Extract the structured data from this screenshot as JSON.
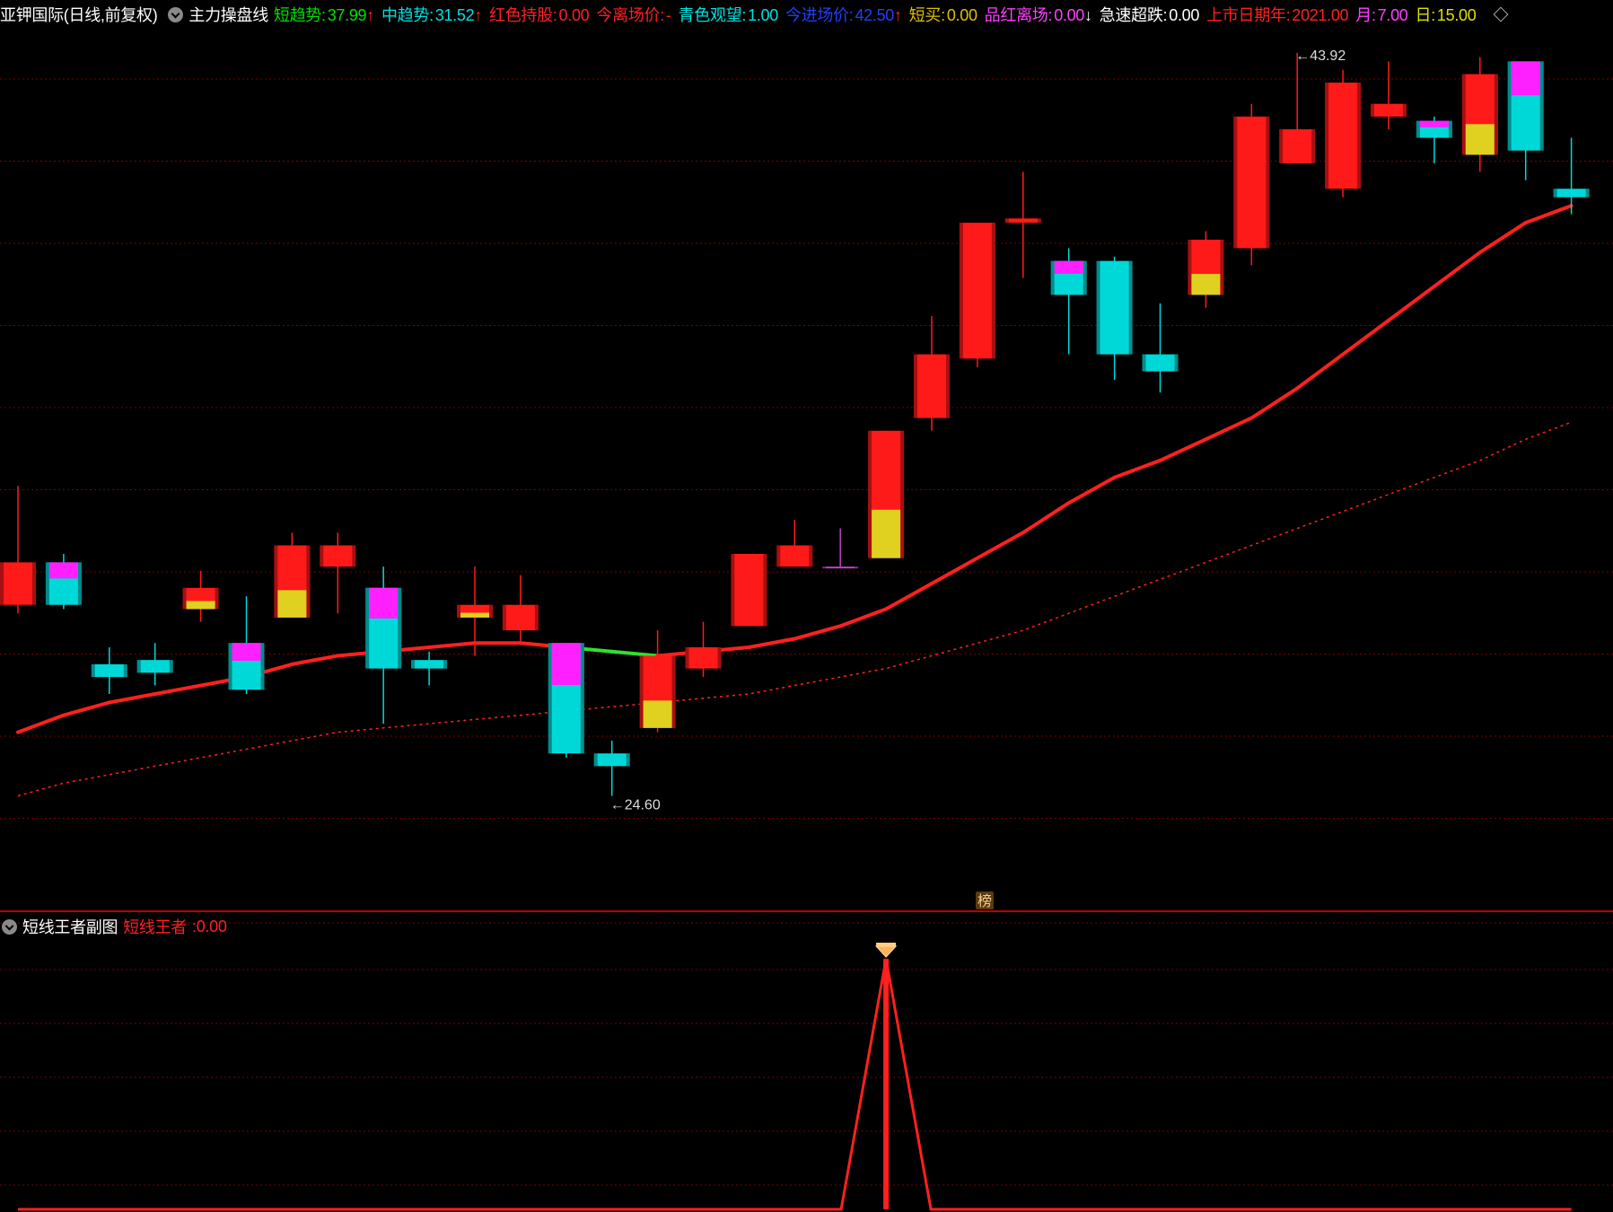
{
  "header": {
    "stock_title": "亚钾国际(日线,前复权)",
    "indicator_name": "主力操盘线",
    "items": [
      {
        "label": "短趋势",
        "value": "37.99",
        "arrow": "↑",
        "color": "#00e000"
      },
      {
        "label": "中趋势",
        "value": "31.52",
        "arrow": "↑",
        "color": "#00e0e0"
      },
      {
        "label": "红色持股",
        "value": "0.00",
        "arrow": "",
        "color": "#ff2020"
      },
      {
        "label": "今离场价",
        "value": "-",
        "arrow": "",
        "color": "#ff2020"
      },
      {
        "label": "青色观望",
        "value": "1.00",
        "arrow": "",
        "color": "#00e0e0"
      },
      {
        "label": "今进场价",
        "value": "42.50",
        "arrow": "↑",
        "color": "#2040ff"
      },
      {
        "label": "短买",
        "value": "0.00",
        "arrow": "",
        "color": "#e0c000"
      },
      {
        "label": "品红离场",
        "value": "0.00",
        "arrow": "↓",
        "color": "#ff40ff"
      },
      {
        "label": "急速超跌",
        "value": "0.00",
        "arrow": "",
        "color": "#ffffff"
      },
      {
        "label": "上市日期年",
        "value": "2021.00",
        "arrow": "",
        "color": "#ff2020"
      },
      {
        "label": "月",
        "value": "7.00",
        "arrow": "",
        "color": "#ff40ff"
      },
      {
        "label": "日",
        "value": "15.00",
        "arrow": "",
        "color": "#e0e000"
      }
    ]
  },
  "subchart_header": {
    "title": "短线王者副图",
    "label": "短线王者",
    "value": "0.00",
    "color": "#ff2020"
  },
  "bang_label": "榜",
  "colors": {
    "background": "#000000",
    "up": "#ff1a1a",
    "down": "#00d8d8",
    "magenta": "#ff20ff",
    "yellow": "#e0d020",
    "ma_red": "#ff2020",
    "ma_green": "#30e030",
    "grid": "#7a0000"
  },
  "chart_data": [
    {
      "type": "candlestick",
      "title": "亚钾国际(日线,前复权)",
      "annotations": [
        {
          "text": "43.92",
          "kind": "high"
        },
        {
          "text": "24.60",
          "kind": "low"
        }
      ],
      "y_range": [
        24.1,
        44.4
      ],
      "candles": [
        {
          "o": 32.0,
          "h": 33.8,
          "l": 30.8,
          "c": 31.0,
          "color": "up"
        },
        {
          "o": 31.0,
          "h": 32.2,
          "l": 30.9,
          "c": 32.0,
          "color": "down",
          "band": "magenta"
        },
        {
          "o": 29.6,
          "h": 30.0,
          "l": 28.9,
          "c": 29.3,
          "color": "down"
        },
        {
          "o": 29.4,
          "h": 30.1,
          "l": 29.1,
          "c": 29.7,
          "color": "down"
        },
        {
          "o": 31.4,
          "h": 31.8,
          "l": 30.6,
          "c": 30.9,
          "color": "up",
          "band": "yellow"
        },
        {
          "o": 29.0,
          "h": 31.2,
          "l": 28.9,
          "c": 30.1,
          "color": "down",
          "band": "magenta"
        },
        {
          "o": 30.7,
          "h": 32.7,
          "l": 30.7,
          "c": 32.4,
          "color": "up",
          "band": "yellow"
        },
        {
          "o": 32.4,
          "h": 32.7,
          "l": 30.8,
          "c": 31.9,
          "color": "up"
        },
        {
          "o": 29.5,
          "h": 31.9,
          "l": 28.2,
          "c": 31.4,
          "color": "down",
          "band": "magenta"
        },
        {
          "o": 29.7,
          "h": 29.9,
          "l": 29.1,
          "c": 29.5,
          "color": "down"
        },
        {
          "o": 31.0,
          "h": 31.9,
          "l": 29.8,
          "c": 30.7,
          "color": "up",
          "band": "yellow"
        },
        {
          "o": 31.0,
          "h": 31.7,
          "l": 30.1,
          "c": 30.4,
          "color": "up"
        },
        {
          "o": 30.1,
          "h": 30.1,
          "l": 27.4,
          "c": 27.5,
          "color": "down",
          "band": "magenta"
        },
        {
          "o": 27.5,
          "h": 27.8,
          "l": 26.5,
          "c": 27.2,
          "color": "down"
        },
        {
          "o": 29.8,
          "h": 30.4,
          "l": 28.0,
          "c": 28.1,
          "color": "up",
          "band": "yellow"
        },
        {
          "o": 30.0,
          "h": 30.6,
          "l": 29.3,
          "c": 29.5,
          "color": "up"
        },
        {
          "o": 32.2,
          "h": 32.2,
          "l": 30.5,
          "c": 30.5,
          "color": "up"
        },
        {
          "o": 32.4,
          "h": 33.0,
          "l": 31.9,
          "c": 31.9,
          "color": "up"
        },
        {
          "o": 31.9,
          "h": 32.8,
          "l": 31.9,
          "c": 31.9,
          "color": "flat"
        },
        {
          "o": 35.1,
          "h": 35.1,
          "l": 32.1,
          "c": 32.1,
          "color": "up",
          "band": "yellow"
        },
        {
          "o": 36.9,
          "h": 37.8,
          "l": 35.1,
          "c": 35.4,
          "color": "up"
        },
        {
          "o": 40.0,
          "h": 40.0,
          "l": 36.6,
          "c": 36.8,
          "color": "up"
        },
        {
          "o": 40.1,
          "h": 41.2,
          "l": 38.7,
          "c": 40.0,
          "color": "up"
        },
        {
          "o": 38.3,
          "h": 39.4,
          "l": 36.9,
          "c": 39.1,
          "color": "down",
          "band": "magenta"
        },
        {
          "o": 36.9,
          "h": 39.2,
          "l": 36.3,
          "c": 39.1,
          "color": "down"
        },
        {
          "o": 36.5,
          "h": 38.1,
          "l": 36.0,
          "c": 36.9,
          "color": "down"
        },
        {
          "o": 39.6,
          "h": 39.8,
          "l": 38.0,
          "c": 38.3,
          "color": "up",
          "band": "yellow"
        },
        {
          "o": 42.5,
          "h": 42.8,
          "l": 39.0,
          "c": 39.4,
          "color": "up"
        },
        {
          "o": 42.2,
          "h": 44.0,
          "l": 41.4,
          "c": 41.4,
          "color": "up"
        },
        {
          "o": 43.3,
          "h": 43.6,
          "l": 40.6,
          "c": 40.8,
          "color": "up"
        },
        {
          "o": 42.8,
          "h": 43.8,
          "l": 42.2,
          "c": 42.5,
          "color": "up"
        },
        {
          "o": 42.0,
          "h": 42.5,
          "l": 41.4,
          "c": 42.4,
          "color": "down",
          "band": "magenta"
        },
        {
          "o": 43.5,
          "h": 43.9,
          "l": 41.2,
          "c": 41.6,
          "color": "up",
          "band": "yellow"
        },
        {
          "o": 41.7,
          "h": 43.8,
          "l": 41.0,
          "c": 43.8,
          "color": "down",
          "band": "magenta"
        },
        {
          "o": 40.6,
          "h": 42.0,
          "l": 40.2,
          "c": 40.8,
          "color": "down"
        }
      ],
      "ma_solid": [
        28.0,
        28.4,
        28.7,
        28.9,
        29.1,
        29.3,
        29.6,
        29.8,
        29.9,
        30.0,
        30.1,
        30.1,
        30.0,
        29.9,
        29.8,
        29.9,
        30.0,
        30.2,
        30.5,
        30.9,
        31.5,
        32.1,
        32.7,
        33.4,
        34.0,
        34.4,
        34.9,
        35.4,
        36.1,
        36.9,
        37.7,
        38.5,
        39.3,
        40.0,
        40.4
      ],
      "ma_dotted": [
        26.5,
        26.8,
        27.0,
        27.2,
        27.4,
        27.6,
        27.8,
        28.0,
        28.1,
        28.2,
        28.3,
        28.4,
        28.5,
        28.6,
        28.7,
        28.8,
        28.9,
        29.1,
        29.3,
        29.5,
        29.8,
        30.1,
        30.4,
        30.8,
        31.2,
        31.6,
        32.0,
        32.4,
        32.8,
        33.2,
        33.6,
        34.0,
        34.4,
        34.9,
        35.3
      ]
    },
    {
      "type": "line",
      "title": "短线王者副图",
      "series": [
        {
          "name": "短线王者",
          "values": [
            0,
            0,
            0,
            0,
            0,
            0,
            0,
            0,
            0,
            0,
            0,
            0,
            0,
            0,
            0,
            0,
            0,
            0,
            0,
            1,
            0,
            0,
            0,
            0,
            0,
            0,
            0,
            0,
            0,
            0,
            0,
            0,
            0,
            0,
            0
          ]
        }
      ],
      "ylim": [
        0,
        1
      ]
    }
  ]
}
